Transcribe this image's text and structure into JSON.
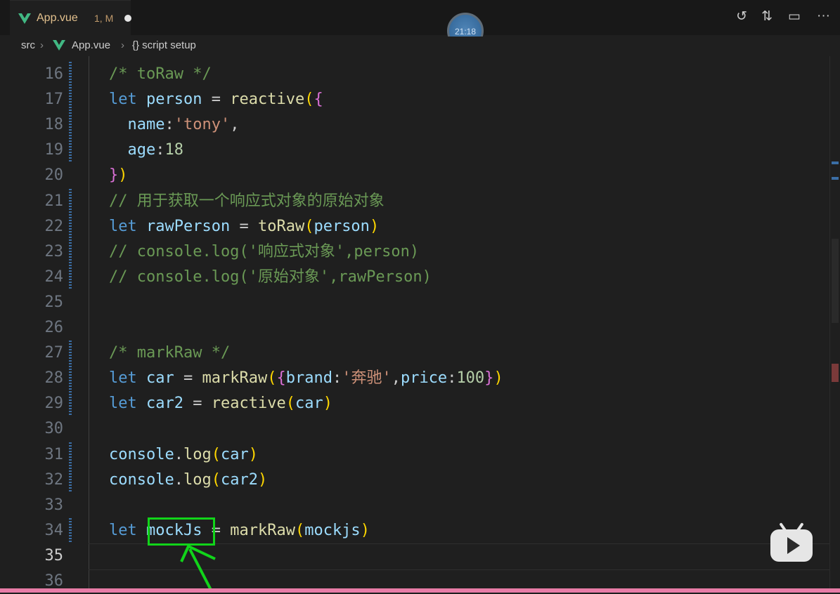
{
  "tab": {
    "title": "App.vue",
    "status": "1, M"
  },
  "clock": "21:18",
  "breadcrumb": {
    "src": "src",
    "file": "App.vue",
    "symbol": "{} script setup"
  },
  "actions": [
    "↺",
    "⇅",
    "▭",
    "···"
  ],
  "lines": [
    {
      "n": "16",
      "html": "<span class='c-cm'>/* toRaw */</span>"
    },
    {
      "n": "17",
      "html": "<span class='c-kw'>let</span> <span class='c-var'>person</span> = <span class='c-fn'>reactive</span><span class='c-p1'>(</span><span class='c-p2'>{</span>"
    },
    {
      "n": "18",
      "html": "  <span class='c-var'>name</span>:<span class='c-str'>'tony'</span>,"
    },
    {
      "n": "19",
      "html": "  <span class='c-var'>age</span>:<span class='c-num'>18</span>"
    },
    {
      "n": "20",
      "html": "<span class='c-p2'>}</span><span class='c-p1'>)</span>"
    },
    {
      "n": "21",
      "html": "<span class='c-cm'>// 用于获取一个响应式对象的原始对象</span>"
    },
    {
      "n": "22",
      "html": "<span class='c-kw'>let</span> <span class='c-var'>rawPerson</span> = <span class='c-fn'>toRaw</span><span class='c-p1'>(</span><span class='c-var'>person</span><span class='c-p1'>)</span>"
    },
    {
      "n": "23",
      "html": "<span class='c-cm'>// console.log('响应式对象',person)</span>"
    },
    {
      "n": "24",
      "html": "<span class='c-cm'>// console.log('原始对象',rawPerson)</span>"
    },
    {
      "n": "25",
      "html": ""
    },
    {
      "n": "26",
      "html": ""
    },
    {
      "n": "27",
      "html": "<span class='c-cm'>/* markRaw */</span>"
    },
    {
      "n": "28",
      "html": "<span class='c-kw'>let</span> <span class='c-var'>car</span> = <span class='c-fn'>markRaw</span><span class='c-p1'>(</span><span class='c-p2'>{</span><span class='c-var'>brand</span>:<span class='c-str'>'奔驰'</span>,<span class='c-var'>price</span>:<span class='c-num'>100</span><span class='c-p2'>}</span><span class='c-p1'>)</span>"
    },
    {
      "n": "29",
      "html": "<span class='c-kw'>let</span> <span class='c-var'>car2</span> = <span class='c-fn'>reactive</span><span class='c-p1'>(</span><span class='c-var'>car</span><span class='c-p1'>)</span>"
    },
    {
      "n": "30",
      "html": ""
    },
    {
      "n": "31",
      "html": "<span class='c-var'>console</span>.<span class='c-fn'>log</span><span class='c-p1'>(</span><span class='c-var'>car</span><span class='c-p1'>)</span>"
    },
    {
      "n": "32",
      "html": "<span class='c-var'>console</span>.<span class='c-fn'>log</span><span class='c-p1'>(</span><span class='c-var'>car2</span><span class='c-p1'>)</span>"
    },
    {
      "n": "33",
      "html": ""
    },
    {
      "n": "34",
      "html": "<span class='c-kw'>let</span> <span class='c-var'>mockJs</span> = <span class='c-fn'>markRaw</span><span class='c-p1'>(</span><span class='c-var'>mockjs</span><span class='c-p1'>)</span>"
    },
    {
      "n": "35",
      "html": ""
    },
    {
      "n": "36",
      "html": ""
    }
  ]
}
